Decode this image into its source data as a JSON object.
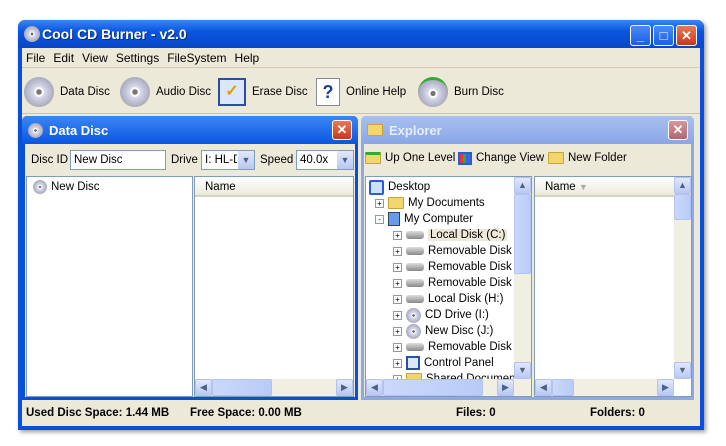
{
  "window": {
    "title": "Cool CD Burner - v2.0",
    "min": "_",
    "max": "□",
    "close": "✕"
  },
  "menu": [
    "File",
    "Edit",
    "View",
    "Settings",
    "FileSystem",
    "Help"
  ],
  "toolbar": [
    "Data Disc",
    "Audio Disc",
    "Erase Disc",
    "Online Help",
    "Burn Disc"
  ],
  "data_disc": {
    "title": "Data Disc",
    "close": "✕",
    "disc_id_label": "Disc ID",
    "disc_id_value": "New Disc",
    "drive_label": "Drive",
    "drive_value": "I: HL-DT",
    "speed_label": "Speed",
    "speed_value": "40.0x",
    "tree_root": "New Disc",
    "column_name": "Name"
  },
  "explorer": {
    "title": "Explorer",
    "close": "✕",
    "up_one_level": "Up One Level",
    "change_view": "Change View",
    "new_folder": "New Folder",
    "column_name": "Name",
    "tree": [
      {
        "label": "Desktop",
        "level": 0,
        "toggle": "",
        "icon": "desktop"
      },
      {
        "label": "My Documents",
        "level": 1,
        "toggle": "+",
        "icon": "folder"
      },
      {
        "label": "My Computer",
        "level": 1,
        "toggle": "−",
        "icon": "computer"
      },
      {
        "label": "Local Disk (C:)",
        "level": 2,
        "toggle": "+",
        "icon": "hdd",
        "selected": true
      },
      {
        "label": "Removable Disk (E:)",
        "level": 2,
        "toggle": "+",
        "icon": "hdd"
      },
      {
        "label": "Removable Disk (F:)",
        "level": 2,
        "toggle": "+",
        "icon": "hdd"
      },
      {
        "label": "Removable Disk (G:)",
        "level": 2,
        "toggle": "+",
        "icon": "hdd"
      },
      {
        "label": "Local Disk (H:)",
        "level": 2,
        "toggle": "+",
        "icon": "hdd"
      },
      {
        "label": "CD Drive (I:)",
        "level": 2,
        "toggle": "+",
        "icon": "cd"
      },
      {
        "label": "New Disc (J:)",
        "level": 2,
        "toggle": "+",
        "icon": "cd"
      },
      {
        "label": "Removable Disk (L:)",
        "level": 2,
        "toggle": "+",
        "icon": "hdd"
      },
      {
        "label": "Control Panel",
        "level": 2,
        "toggle": "+",
        "icon": "control"
      },
      {
        "label": "Shared Documents",
        "level": 2,
        "toggle": "+",
        "icon": "folder"
      }
    ]
  },
  "status": {
    "used": "Used Disc Space: 1.44 MB",
    "free": "Free Space: 0.00 MB",
    "files": "Files: 0",
    "folders": "Folders: 0"
  }
}
